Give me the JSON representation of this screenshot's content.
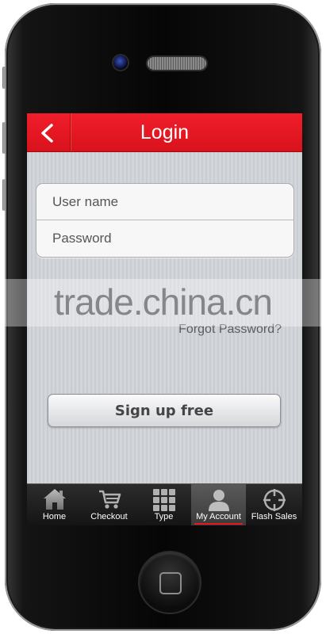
{
  "header": {
    "title": "Login"
  },
  "login_form": {
    "username_placeholder": "User name",
    "password_placeholder": "Password"
  },
  "forgot_password_label": "Forgot Password?",
  "signup_label": "Sign up free",
  "tabbar": {
    "active_index": 3,
    "items": [
      {
        "label": "Home",
        "icon": "home-icon"
      },
      {
        "label": "Checkout",
        "icon": "cart-icon"
      },
      {
        "label": "Type",
        "icon": "grid-icon"
      },
      {
        "label": "My Account",
        "icon": "user-icon"
      },
      {
        "label": "Flash Sales",
        "icon": "crosshair-icon"
      }
    ]
  },
  "watermark": "trade.china.cn",
  "colors": {
    "header_red": "#e8141e",
    "tabbar_bg": "#1c1c1c",
    "screen_bg": "#cdd0d5"
  }
}
